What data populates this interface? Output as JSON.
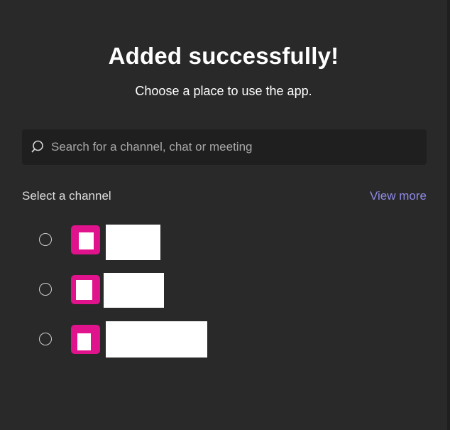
{
  "dialog": {
    "title": "Added successfully!",
    "subtitle": "Choose a place to use the app."
  },
  "search": {
    "placeholder": "Search for a channel, chat or meeting",
    "icon": "search-icon"
  },
  "channels": {
    "section_label": "Select a channel",
    "view_more_label": "View more"
  },
  "colors": {
    "background": "#292929",
    "search_background": "#1f1f1f",
    "link": "#8e8ae5",
    "avatar": "#e0138c"
  }
}
